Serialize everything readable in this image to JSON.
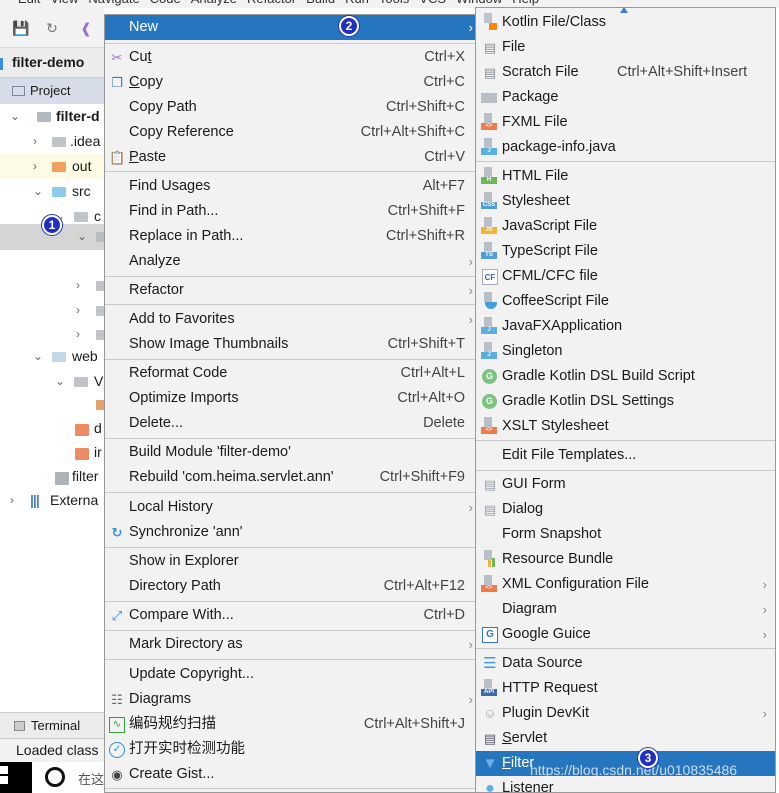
{
  "menubar": {
    "items": [
      "Edit",
      "View",
      "Navigate",
      "Code",
      "Analyze",
      "Refactor",
      "Build",
      "Run",
      "Tools",
      "VCS",
      "Window",
      "Help"
    ]
  },
  "toolbar": {
    "icons": [
      "save-icon",
      "sync-icon",
      "back-icon"
    ]
  },
  "breadcrumb": "filter-demo",
  "project_tab": "Project",
  "tree": [
    {
      "label": "filter-d",
      "expanded": true,
      "icon": "module-folder",
      "bold": true
    },
    {
      "label": ".idea",
      "expanded": false,
      "icon": "folder-gray"
    },
    {
      "label": "out",
      "expanded": false,
      "icon": "folder-orange"
    },
    {
      "label": "src",
      "expanded": true,
      "icon": "folder-blue"
    },
    {
      "label": "c",
      "expanded": true,
      "icon": "package"
    },
    {
      "label": "",
      "expanded": true,
      "icon": "package",
      "selected": true
    },
    {
      "label": "",
      "expanded": false,
      "icon": "package"
    },
    {
      "label": "",
      "expanded": false,
      "icon": "package"
    },
    {
      "label": "",
      "expanded": false,
      "icon": "package"
    },
    {
      "label": "web",
      "expanded": true,
      "icon": "folder-web"
    },
    {
      "label": "V",
      "expanded": true,
      "icon": "folder-gray"
    },
    {
      "label": "",
      "icon": "xml-file"
    },
    {
      "label": "d",
      "icon": "jsp-file"
    },
    {
      "label": "ir",
      "icon": "jsp-file"
    },
    {
      "label": "filter",
      "icon": "iml-file"
    },
    {
      "label": "Externa",
      "expanded": false,
      "icon": "libraries"
    }
  ],
  "badges": {
    "one": "1",
    "two": "2",
    "three": "3"
  },
  "terminal_tab": "Terminal",
  "status_text": "Loaded class",
  "taskbar_search": "在这",
  "context_menu": {
    "items": [
      {
        "label": "New",
        "submenu": true,
        "selected": true
      },
      {
        "label": "Cut",
        "underline": "t",
        "shortcut": "Ctrl+X",
        "icon": "scissors-icon"
      },
      {
        "label": "Copy",
        "underline": "C",
        "shortcut": "Ctrl+C",
        "icon": "copy-icon"
      },
      {
        "label": "Copy Path",
        "shortcut": "Ctrl+Shift+C"
      },
      {
        "label": "Copy Reference",
        "shortcut": "Ctrl+Alt+Shift+C"
      },
      {
        "label": "Paste",
        "underline": "P",
        "shortcut": "Ctrl+V",
        "icon": "paste-icon"
      },
      {
        "label": "Find Usages",
        "shortcut": "Alt+F7"
      },
      {
        "label": "Find in Path...",
        "shortcut": "Ctrl+Shift+F"
      },
      {
        "label": "Replace in Path...",
        "shortcut": "Ctrl+Shift+R"
      },
      {
        "label": "Analyze",
        "submenu": true
      },
      {
        "label": "Refactor",
        "submenu": true
      },
      {
        "label": "Add to Favorites",
        "submenu": true
      },
      {
        "label": "Show Image Thumbnails",
        "shortcut": "Ctrl+Shift+T"
      },
      {
        "label": "Reformat Code",
        "shortcut": "Ctrl+Alt+L"
      },
      {
        "label": "Optimize Imports",
        "shortcut": "Ctrl+Alt+O"
      },
      {
        "label": "Delete...",
        "shortcut": "Delete"
      },
      {
        "label": "Build Module 'filter-demo'"
      },
      {
        "label": "Rebuild 'com.heima.servlet.ann'",
        "shortcut": "Ctrl+Shift+F9"
      },
      {
        "label": "Local History",
        "submenu": true
      },
      {
        "label": "Synchronize 'ann'",
        "icon": "synchronize-icon"
      },
      {
        "label": "Show in Explorer"
      },
      {
        "label": "Directory Path",
        "shortcut": "Ctrl+Alt+F12"
      },
      {
        "label": "Compare With...",
        "shortcut": "Ctrl+D",
        "icon": "compare-icon"
      },
      {
        "label": "Mark Directory as",
        "submenu": true
      },
      {
        "label": "Update Copyright..."
      },
      {
        "label": "Diagrams",
        "submenu": true,
        "icon": "diagrams-icon"
      },
      {
        "label": "编码规约扫描",
        "shortcut": "Ctrl+Alt+Shift+J",
        "icon": "code-scan-icon"
      },
      {
        "label": "打开实时检测功能",
        "icon": "realtime-check-icon"
      },
      {
        "label": "Create Gist...",
        "icon": "github-icon"
      }
    ]
  },
  "new_submenu": {
    "items": [
      {
        "label": "Kotlin File/Class",
        "icon": "kotlin-file-icon"
      },
      {
        "label": "File",
        "icon": "file-icon"
      },
      {
        "label": "Scratch File",
        "shortcut": "Ctrl+Alt+Shift+Insert",
        "icon": "scratch-file-icon"
      },
      {
        "label": "Package",
        "icon": "package-icon"
      },
      {
        "label": "FXML File",
        "icon": "fxml-file-icon"
      },
      {
        "label": "package-info.java",
        "icon": "java-file-icon"
      },
      {
        "label": "HTML File",
        "icon": "html-file-icon"
      },
      {
        "label": "Stylesheet",
        "icon": "css-file-icon"
      },
      {
        "label": "JavaScript File",
        "icon": "js-file-icon"
      },
      {
        "label": "TypeScript File",
        "icon": "ts-file-icon"
      },
      {
        "label": "CFML/CFC file",
        "icon": "cfml-file-icon"
      },
      {
        "label": "CoffeeScript File",
        "icon": "coffeescript-file-icon"
      },
      {
        "label": "JavaFXApplication",
        "icon": "java-file-icon"
      },
      {
        "label": "Singleton",
        "icon": "java-file-icon"
      },
      {
        "label": "Gradle Kotlin DSL Build Script",
        "icon": "gradle-icon"
      },
      {
        "label": "Gradle Kotlin DSL Settings",
        "icon": "gradle-icon"
      },
      {
        "label": "XSLT Stylesheet",
        "icon": "xslt-file-icon"
      },
      {
        "label": "Edit File Templates..."
      },
      {
        "label": "GUI Form",
        "icon": "gui-form-icon"
      },
      {
        "label": "Dialog",
        "icon": "dialog-icon"
      },
      {
        "label": "Form Snapshot"
      },
      {
        "label": "Resource Bundle",
        "icon": "resource-bundle-icon"
      },
      {
        "label": "XML Configuration File",
        "submenu": true,
        "icon": "xml-file-icon"
      },
      {
        "label": "Diagram",
        "submenu": true
      },
      {
        "label": "Google Guice",
        "submenu": true,
        "icon": "google-guice-icon"
      },
      {
        "label": "Data Source",
        "icon": "database-icon"
      },
      {
        "label": "HTTP Request",
        "icon": "http-request-icon"
      },
      {
        "label": "Plugin DevKit",
        "submenu": true,
        "icon": "plugin-icon"
      },
      {
        "label": "Servlet",
        "underline": "S",
        "icon": "servlet-icon"
      },
      {
        "label": "Filter",
        "underline": "F",
        "selected": true,
        "icon": "filter-icon"
      },
      {
        "label": "Listener",
        "icon": "listener-icon"
      }
    ]
  },
  "watermark": "https://blog.csdn.net/u010835486",
  "colors": {
    "selection": "#2675bf",
    "menu_bg": "#f2f2f2",
    "badge": "#1f2fc4"
  }
}
